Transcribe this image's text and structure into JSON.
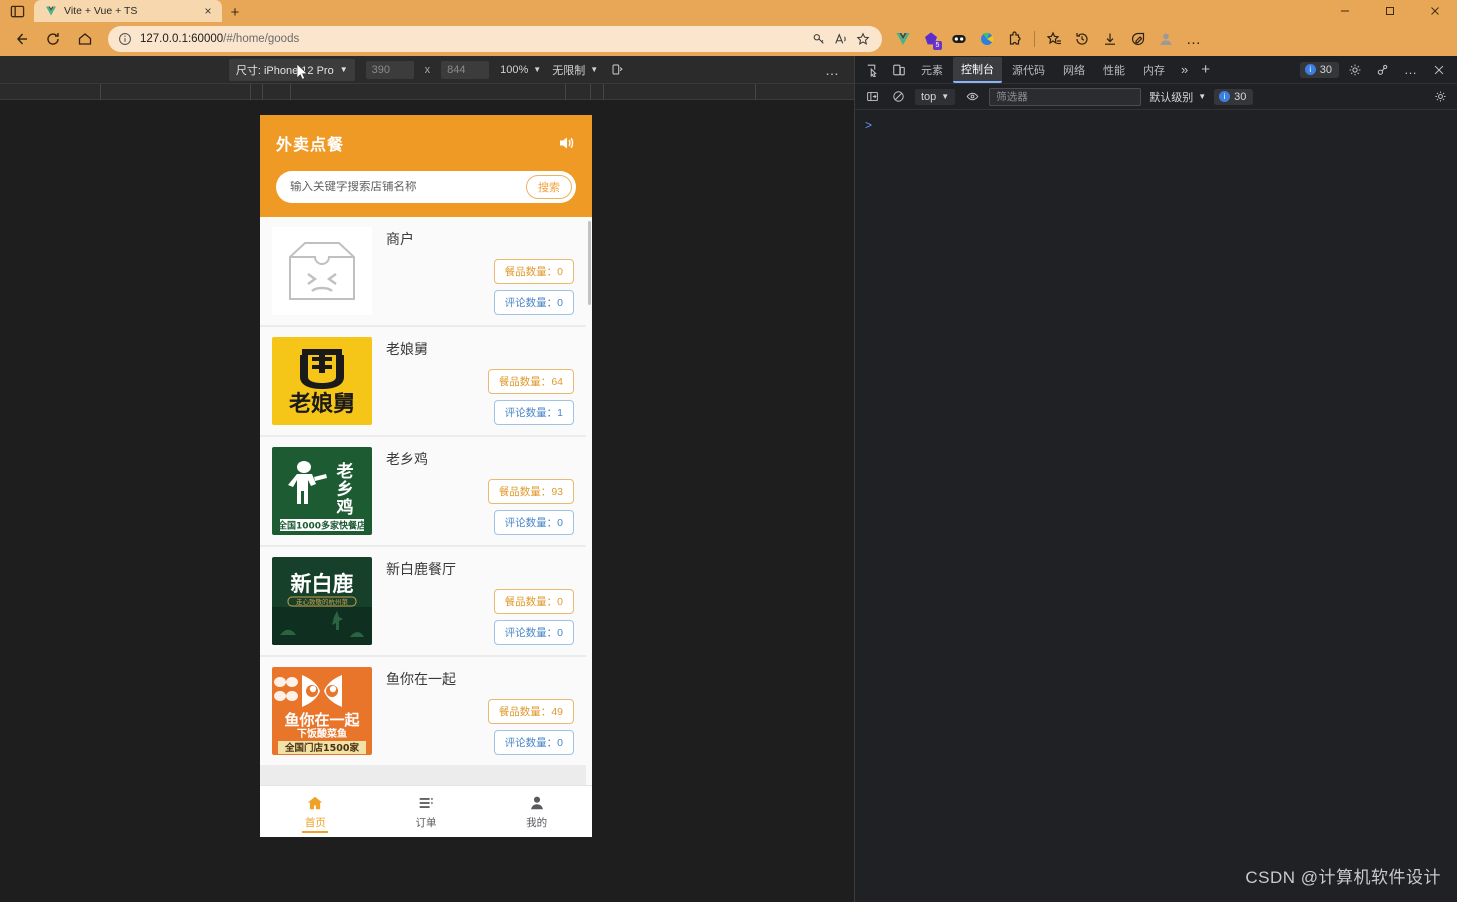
{
  "browser": {
    "tab": {
      "title": "Vite + Vue + TS",
      "favicon": "vue-logo-icon",
      "close_label": "×"
    },
    "newtab_label": "+",
    "window": {
      "minimize": "—",
      "maximize": "□",
      "close": "✕"
    },
    "nav": {
      "back": "back-arrow-icon",
      "reload": "reload-icon",
      "home": "home-icon"
    },
    "address": {
      "scheme_icon": "info-icon",
      "url_host": "127.0.0.1:60000",
      "url_path": "/#/home/goods"
    },
    "toolbar_right": [
      "key-icon",
      "read-aloud-icon",
      "favorite-add-icon"
    ],
    "extensions": [
      {
        "name": "vue-devtools-icon",
        "badge": ""
      },
      {
        "name": "purple-extension-icon",
        "badge": "5"
      },
      {
        "name": "dark-extension-icon",
        "badge": ""
      },
      {
        "name": "colorful-extension-icon",
        "badge": ""
      },
      {
        "name": "puzzle-extensions-icon",
        "badge": ""
      }
    ],
    "actions": [
      "collections-icon",
      "history-icon",
      "downloads-icon",
      "screenshot-icon",
      "profile-icon",
      "settings-more-icon"
    ]
  },
  "emulation": {
    "device_label": "尺寸: iPhone 12 Pro",
    "width": "390",
    "times": "x",
    "height": "844",
    "zoom": "100%",
    "throttling": "无限制",
    "rotate_icon": "rotate-icon",
    "more": "…"
  },
  "app": {
    "title": "外卖点餐",
    "sound_icon": "speaker-icon",
    "search": {
      "placeholder": "输入关键字搜索店铺名称",
      "value": "",
      "button": "搜索"
    },
    "shops": [
      {
        "name": "商户",
        "logo": "broken-image-placeholder",
        "goods_label": "餐品数量：",
        "goods_count": "0",
        "comment_label": "评论数量：",
        "comment_count": "0"
      },
      {
        "name": "老娘舅",
        "logo": "laoniangjiu-logo",
        "goods_label": "餐品数量：",
        "goods_count": "64",
        "comment_label": "评论数量：",
        "comment_count": "1"
      },
      {
        "name": "老乡鸡",
        "logo": "laoxiangji-logo",
        "goods_label": "餐品数量：",
        "goods_count": "93",
        "comment_label": "评论数量：",
        "comment_count": "0"
      },
      {
        "name": "新白鹿餐厅",
        "logo": "xinbailu-logo",
        "goods_label": "餐品数量：",
        "goods_count": "0",
        "comment_label": "评论数量：",
        "comment_count": "0"
      },
      {
        "name": "鱼你在一起",
        "logo": "yunizaiyiqi-logo",
        "goods_label": "餐品数量：",
        "goods_count": "49",
        "comment_label": "评论数量：",
        "comment_count": "0"
      }
    ],
    "tabbar": [
      {
        "label": "首页",
        "icon": "home-icon",
        "active": true
      },
      {
        "label": "订单",
        "icon": "order-list-icon",
        "active": false
      },
      {
        "label": "我的",
        "icon": "person-icon",
        "active": false
      }
    ]
  },
  "devtools": {
    "inspect_icon": "inspect-element-icon",
    "device_toggle_icon": "device-toolbar-icon",
    "tabs": [
      {
        "label": "元素",
        "active": false
      },
      {
        "label": "控制台",
        "active": true
      },
      {
        "label": "源代码",
        "active": false
      },
      {
        "label": "网络",
        "active": false
      },
      {
        "label": "性能",
        "active": false
      },
      {
        "label": "内存",
        "active": false
      }
    ],
    "overflow": "»",
    "add_tab": "+",
    "issues_count": "30",
    "right_icons": [
      "settings-gear-icon",
      "customize-devtools-icon",
      "more-options-icon",
      "close-devtools-icon"
    ],
    "console": {
      "sidebar_icon": "console-sidebar-icon",
      "clear_icon": "clear-console-icon",
      "context": "top",
      "eye_icon": "live-expression-icon",
      "filter_placeholder": "筛选器",
      "filter_value": "",
      "level": "默认级别",
      "badge_count": "30",
      "settings_icon": "console-settings-icon",
      "prompt": ">"
    }
  },
  "watermark": "CSDN @计算机软件设计",
  "colors": {
    "brand_orange": "#f09a26",
    "chrome_orange": "#e8a757",
    "badge_goods": "#e09a2e",
    "badge_comment": "#4a86c8",
    "devtools_bg": "#202124"
  }
}
